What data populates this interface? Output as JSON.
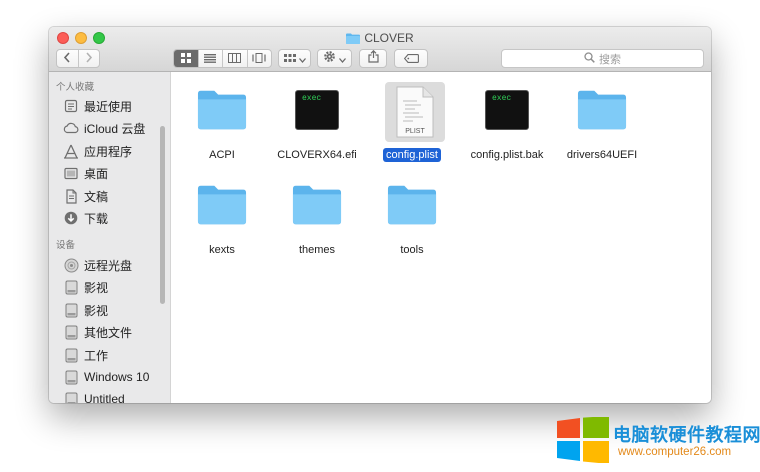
{
  "window": {
    "title": "CLOVER"
  },
  "toolbar": {
    "back_icon": "chevron-left-icon",
    "forward_icon": "chevron-right-icon",
    "views": [
      "icon-view",
      "list-view",
      "column-view",
      "coverflow-view"
    ],
    "arrange_icon": "arrange-grid-icon",
    "action_icon": "gear-icon",
    "share_icon": "share-icon",
    "tag_icon": "tag-icon",
    "search_placeholder": "搜索"
  },
  "sidebar": {
    "favorites_header": "个人收藏",
    "favorites": [
      {
        "label": "最近使用",
        "icon": "recents-icon"
      },
      {
        "label": "iCloud 云盘",
        "icon": "cloud-icon"
      },
      {
        "label": "应用程序",
        "icon": "applications-icon"
      },
      {
        "label": "桌面",
        "icon": "desktop-icon"
      },
      {
        "label": "文稿",
        "icon": "documents-icon"
      },
      {
        "label": "下载",
        "icon": "download-icon"
      }
    ],
    "devices_header": "设备",
    "devices": [
      {
        "label": "远程光盘",
        "icon": "disc-icon"
      },
      {
        "label": "影视",
        "icon": "drive-icon"
      },
      {
        "label": "影视",
        "icon": "drive-icon"
      },
      {
        "label": "其他文件",
        "icon": "drive-icon"
      },
      {
        "label": "工作",
        "icon": "drive-icon"
      },
      {
        "label": "Windows 10",
        "icon": "drive-icon"
      },
      {
        "label": "Untitled",
        "icon": "drive-icon"
      }
    ]
  },
  "files": [
    {
      "name": "ACPI",
      "type": "folder",
      "selected": false
    },
    {
      "name": "CLOVERX64.efi",
      "type": "exec",
      "selected": false,
      "badge": "exec"
    },
    {
      "name": "config.plist",
      "type": "plist",
      "selected": true,
      "badge": "PLIST"
    },
    {
      "name": "config.plist.bak",
      "type": "exec",
      "selected": false,
      "badge": "exec"
    },
    {
      "name": "drivers64UEFI",
      "type": "folder",
      "selected": false
    },
    {
      "name": "kexts",
      "type": "folder",
      "selected": false
    },
    {
      "name": "themes",
      "type": "folder",
      "selected": false
    },
    {
      "name": "tools",
      "type": "folder",
      "selected": false
    }
  ],
  "watermark": {
    "title": "电脑软硬件教程网",
    "url": "www.computer26.com"
  },
  "colors": {
    "selection": "#1e63d6",
    "folder": "#69c1f5",
    "exec_text": "#31d159"
  }
}
